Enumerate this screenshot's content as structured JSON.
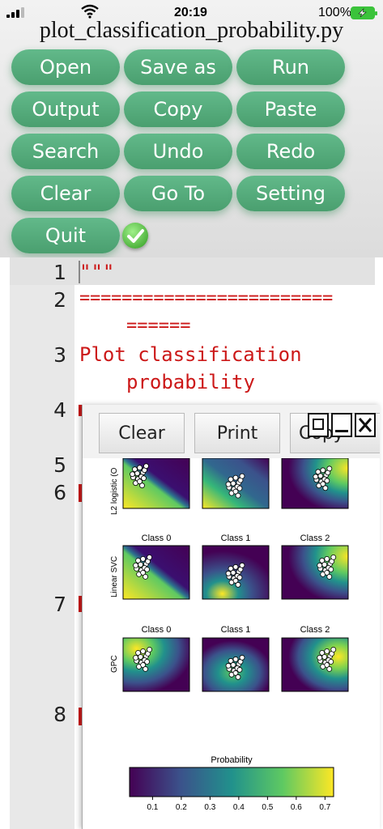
{
  "status": {
    "time": "20:19",
    "battery": "100%"
  },
  "file_title": "plot_classification_probability.py",
  "toolbar": {
    "open": "Open",
    "save_as": "Save as",
    "run": "Run",
    "output": "Output",
    "copy": "Copy",
    "paste": "Paste",
    "search": "Search",
    "undo": "Undo",
    "redo": "Redo",
    "clear": "Clear",
    "go_to": "Go To",
    "setting": "Setting",
    "quit": "Quit"
  },
  "editor": {
    "line_numbers": [
      "1",
      "2",
      "3",
      "4",
      "5",
      "6",
      "7",
      "8"
    ],
    "line1": "\"\"\"",
    "line2a": "========================",
    "line2b": "======",
    "line3a": "Plot classification",
    "line3b": "probability"
  },
  "plot_window": {
    "clear": "Clear",
    "print": "Print",
    "partial_button": "Copy"
  },
  "figure": {
    "row_labels": [
      "L2 logistic (O",
      "Linear SVC",
      "GPC"
    ],
    "class_titles": [
      "Class 0",
      "Class 1",
      "Class 2"
    ],
    "colorbar_title": "Probability",
    "colorbar_ticks": [
      "0.1",
      "0.2",
      "0.3",
      "0.4",
      "0.5",
      "0.6",
      "0.7"
    ],
    "colormap": [
      "#440154",
      "#3b528b",
      "#21918c",
      "#5ec962",
      "#fde725"
    ]
  }
}
